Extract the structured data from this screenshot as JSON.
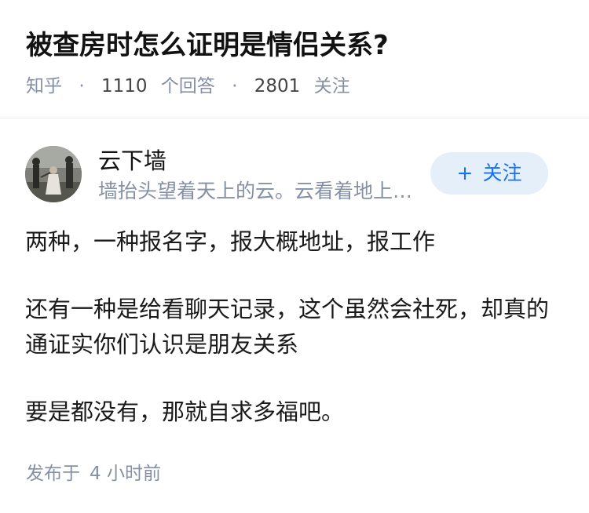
{
  "question": {
    "title": "被查房时怎么证明是情侣关系?",
    "source": "知乎",
    "separator": "·",
    "answer_count": "1110",
    "answer_label": "个回答",
    "follower_count": "2801",
    "follower_label": "关注"
  },
  "author": {
    "name": "云下墙",
    "bio": "墙抬头望着天上的云。云看着地上的墙",
    "follow_button_label": "关注",
    "follow_button_icon": "+"
  },
  "answer": {
    "paragraphs": [
      "两种，一种报名字，报大概地址，报工作",
      "还有一种是给看聊天记录，这个虽然会社死，却真的通证实你们认识是朋友关系",
      "要是都没有，那就自求多福吧。"
    ],
    "published_label": "发布于",
    "published_time": "4 小时前"
  },
  "colors": {
    "meta_gray": "#8590a6",
    "accent_blue": "#1772f6",
    "button_bg": "#e5effa"
  }
}
